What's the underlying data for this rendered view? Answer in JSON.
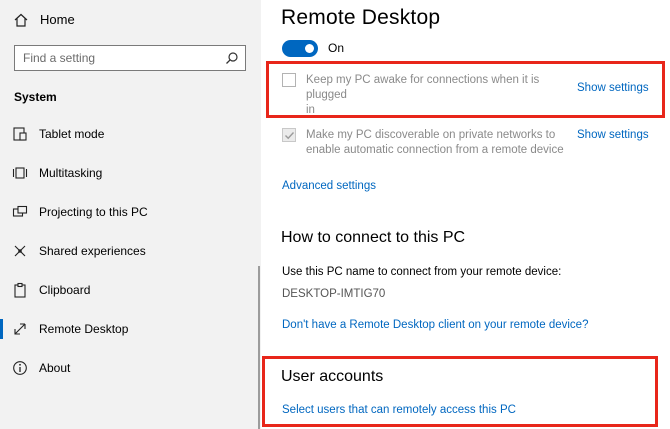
{
  "sidebar": {
    "home_label": "Home",
    "search_placeholder": "Find a setting",
    "section_title": "System",
    "items": [
      {
        "label": "Tablet mode",
        "icon": "tablet-mode-icon"
      },
      {
        "label": "Multitasking",
        "icon": "multitasking-icon"
      },
      {
        "label": "Projecting to this PC",
        "icon": "projecting-icon"
      },
      {
        "label": "Shared experiences",
        "icon": "shared-experiences-icon"
      },
      {
        "label": "Clipboard",
        "icon": "clipboard-icon"
      },
      {
        "label": "Remote Desktop",
        "icon": "remote-desktop-icon",
        "selected": true
      },
      {
        "label": "About",
        "icon": "info-icon"
      }
    ]
  },
  "main": {
    "title": "Remote Desktop",
    "toggle": {
      "state_label": "On",
      "on": true
    },
    "options": [
      {
        "text_line1": "Keep my PC awake for connections when it is plugged",
        "text_line2": "in",
        "checked": false,
        "link": "Show settings"
      },
      {
        "text_line1": "Make my PC discoverable on private networks to",
        "text_line2": "enable automatic connection from a remote device",
        "checked": true,
        "link": "Show settings"
      }
    ],
    "advanced_link": "Advanced settings",
    "connect": {
      "heading": "How to connect to this PC",
      "instruction": "Use this PC name to connect from your remote device:",
      "pc_name": "DESKTOP-IMTIG70",
      "client_link": "Don't have a Remote Desktop client on your remote device?"
    },
    "accounts": {
      "heading": "User accounts",
      "link": "Select users that can remotely access this PC"
    }
  },
  "colors": {
    "accent": "#0067c0",
    "highlight": "#e8261a",
    "sidebar_bg": "#f2f2f2"
  }
}
